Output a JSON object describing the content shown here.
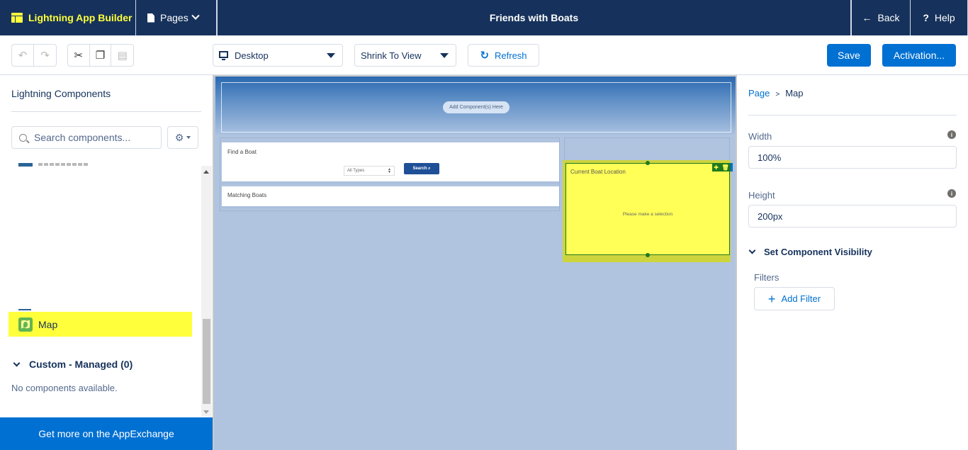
{
  "topbar": {
    "app_name": "Lightning App Builder",
    "pages_label": "Pages",
    "page_title": "Friends with Boats",
    "back_label": "Back",
    "help_label": "Help",
    "brand_color": "#16325c",
    "accent_color": "#ffff3c"
  },
  "toolbar": {
    "undo_icon": "undo-icon",
    "redo_icon": "redo-icon",
    "cut_icon": "scissors-icon",
    "copy_icon": "copy-icon",
    "paste_icon": "paste-icon",
    "device_select": "Desktop",
    "view_select": "Shrink To View",
    "refresh_label": "Refresh",
    "save_label": "Save",
    "activation_label": "Activation..."
  },
  "left_panel": {
    "heading": "Lightning Components",
    "search_placeholder": "Search components...",
    "highlighted_item": "Map",
    "section_title": "Custom - Managed (0)",
    "empty_message": "No components available.",
    "appexchange_label": "Get more on the AppExchange"
  },
  "canvas": {
    "add_components_label": "Add Component(s) Here",
    "find_boat_title": "Find a Boat",
    "type_select": "All Types",
    "search_button": "Search",
    "matching_boats_title": "Matching Boats",
    "selected_component_title": "Current Boat Location",
    "selected_component_message": "Please make a selection",
    "selection_color": "#ffff57"
  },
  "right_panel": {
    "breadcrumb_root": "Page",
    "breadcrumb_separator": ">",
    "breadcrumb_current": "Map",
    "width_label": "Width",
    "width_value": "100%",
    "height_label": "Height",
    "height_value": "200px",
    "visibility_section": "Set Component Visibility",
    "filters_label": "Filters",
    "add_filter_label": "Add Filter"
  }
}
